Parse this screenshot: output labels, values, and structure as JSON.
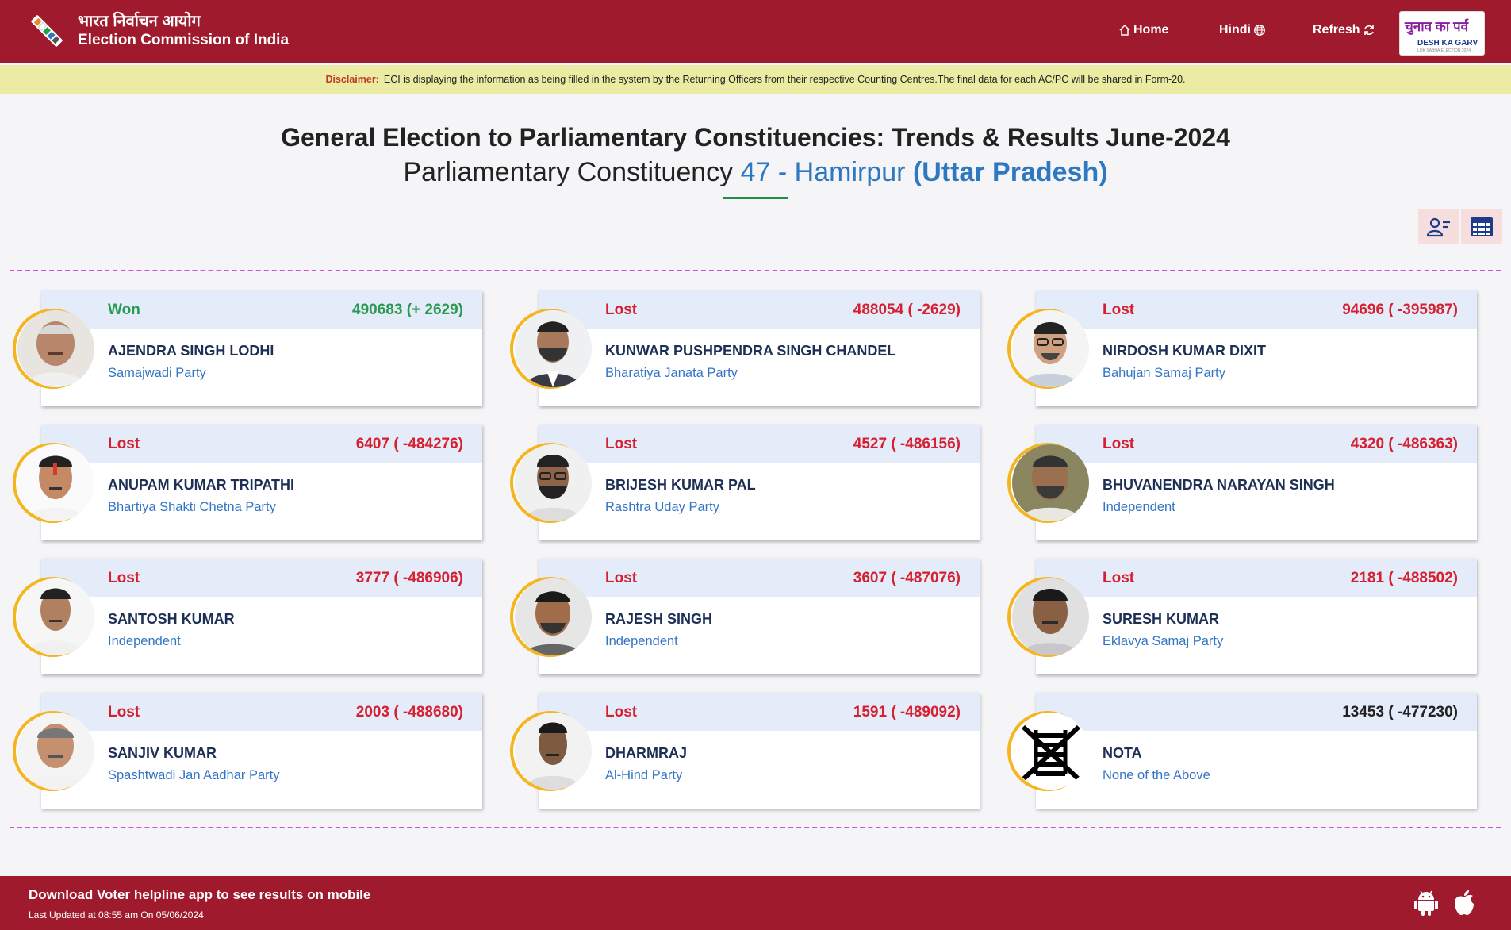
{
  "header": {
    "title_hindi": "भारत निर्वाचन आयोग",
    "title_english": "Election Commission of India",
    "nav": {
      "home": "Home",
      "hindi": "Hindi",
      "refresh": "Refresh"
    },
    "badge": {
      "line1": "चुनाव का पर्व",
      "line2": "DESH KA GARV",
      "line3": "LOK SABHA ELECTION 2024"
    }
  },
  "disclaimer": {
    "label": "Disclaimer:",
    "text": "ECI is displaying the information as being filled in the system by the Returning Officers from their respective Counting Centres.The final data for each AC/PC will be shared in Form-20."
  },
  "title": {
    "line1": "General Election to Parliamentary Constituencies: Trends & Results June-2024",
    "prefix": "Parliamentary Constituency",
    "constituency": "47 - Hamirpur",
    "state": "(Uttar Pradesh)"
  },
  "candidates": [
    {
      "status": "Won",
      "votes": "490683 (+ 2629)",
      "name": "AJENDRA SINGH LODHI",
      "party": "Samajwadi Party"
    },
    {
      "status": "Lost",
      "votes": "488054 ( -2629)",
      "name": "KUNWAR PUSHPENDRA SINGH CHANDEL",
      "party": "Bharatiya Janata Party"
    },
    {
      "status": "Lost",
      "votes": "94696 ( -395987)",
      "name": "NIRDOSH KUMAR DIXIT",
      "party": "Bahujan Samaj Party"
    },
    {
      "status": "Lost",
      "votes": "6407 ( -484276)",
      "name": "ANUPAM KUMAR TRIPATHI",
      "party": "Bhartiya Shakti Chetna Party"
    },
    {
      "status": "Lost",
      "votes": "4527 ( -486156)",
      "name": "BRIJESH KUMAR PAL",
      "party": "Rashtra Uday Party"
    },
    {
      "status": "Lost",
      "votes": "4320 ( -486363)",
      "name": "BHUVANENDRA NARAYAN SINGH",
      "party": "Independent"
    },
    {
      "status": "Lost",
      "votes": "3777 ( -486906)",
      "name": "SANTOSH KUMAR",
      "party": "Independent"
    },
    {
      "status": "Lost",
      "votes": "3607 ( -487076)",
      "name": "RAJESH SINGH",
      "party": "Independent"
    },
    {
      "status": "Lost",
      "votes": "2181 ( -488502)",
      "name": "SURESH KUMAR",
      "party": "Eklavya Samaj Party"
    },
    {
      "status": "Lost",
      "votes": "2003 ( -488680)",
      "name": "SANJIV KUMAR",
      "party": "Spashtwadi Jan Aadhar Party"
    },
    {
      "status": "Lost",
      "votes": "1591 ( -489092)",
      "name": "DHARMRAJ",
      "party": "Al-Hind Party"
    },
    {
      "status": "",
      "votes": "13453 ( -477230)",
      "name": "NOTA",
      "party": "None of the Above"
    }
  ],
  "footer": {
    "line1": "Download Voter helpline app to see results on mobile",
    "line2": "Last Updated at 08:55 am On 05/06/2024"
  },
  "colors": {
    "header_bg": "#9f1a2c",
    "disclaimer_bg": "#ebeba3",
    "won": "#2a9a53",
    "lost": "#d62031",
    "accent_blue": "#2e78c2",
    "photo_ring": "#f5b51e",
    "dashed_line": "#d64ed6"
  }
}
